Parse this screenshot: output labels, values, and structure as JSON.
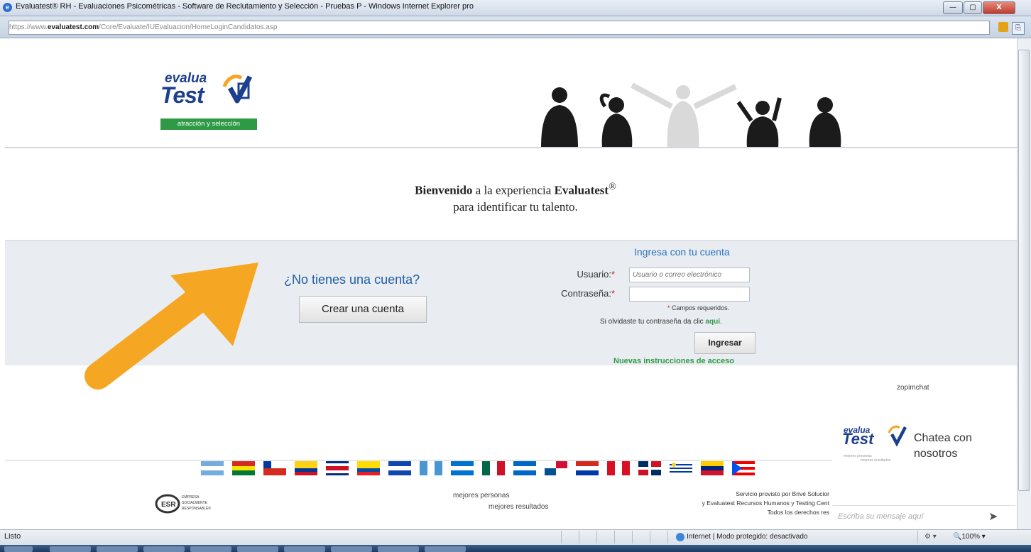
{
  "window": {
    "title": "Evaluatest® RH - Evaluaciones Psicométricas - Software de Reclutamiento y Selección - Pruebas P - Windows Internet Explorer pro",
    "minimize": "—",
    "maximize": "▢",
    "close": "X"
  },
  "address": {
    "url_prefix": "https://www.",
    "url_domain": "evaluatest.com",
    "url_path": "/Core/Evaluate/IUEvaluacion/HomeLoginCandidatos.asp"
  },
  "header": {
    "logo_word1": "evalua",
    "logo_word2": "Test",
    "logo_tagline": "atracción y selección"
  },
  "welcome": {
    "bold1": "Bienvenido",
    "text1": " a la experiencia ",
    "bold2": "Evaluatest",
    "mark": "®",
    "line2": "para identificar tu talento."
  },
  "signup": {
    "question": "¿No tienes una cuenta?",
    "button": "Crear una cuenta"
  },
  "login": {
    "title": "Ingresa con tu cuenta",
    "user_label": "Usuario:",
    "user_placeholder": "Usuario o correo electrónico",
    "pass_label": "Contraseña:",
    "required_mark": "*",
    "required_note": "Campos requeridos.",
    "forgot_text": "Si olvidaste tu contraseña da clic ",
    "forgot_link": "aquí",
    "forgot_end": ".",
    "button": "Ingresar",
    "new_instructions": "Nuevas instrucciones de acceso"
  },
  "chat": {
    "provider": "zopimchat",
    "logo_word1": "evalua",
    "logo_word2": "Test",
    "logo_tag1": "mejores personas",
    "logo_tag2": "mejores resultados",
    "cta_line1": "Chatea con",
    "cta_line2": "nosotros",
    "input_placeholder": "Escriba su mensaje aquí",
    "send_icon": "send-icon"
  },
  "footer": {
    "esr_line1": "EMPRESA",
    "esr_line2": "SOCIALMENTE",
    "esr_line3": "RESPONSABLE®",
    "esr_badge": "ESR",
    "tagline1": "mejores personas",
    "tagline2": "mejores resultados",
    "service1": "Servicio provisto por Brivé Solucior",
    "service2": "y Evaluatest Recursos Humanos y Testing Cent",
    "service3": "Todos los derechos res"
  },
  "statusbar": {
    "ready": "Listo",
    "zone": "Internet | Modo protegido: desactivado",
    "tools": "⚙ ▾",
    "zoom": "🔍100%  ▾"
  },
  "colors": {
    "brand_blue": "#1d3f8f",
    "brand_green": "#2f9a46",
    "link_blue": "#2a73c0",
    "arrow_orange": "#f5a623"
  }
}
